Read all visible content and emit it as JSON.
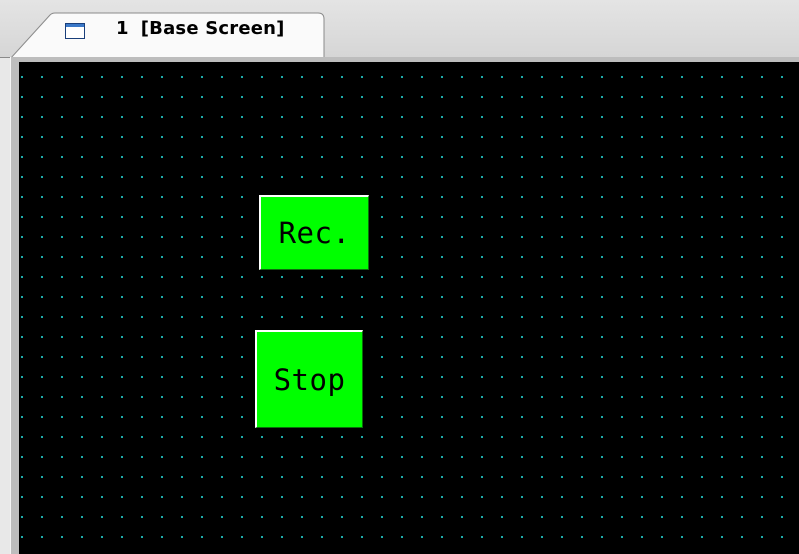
{
  "tab": {
    "number": "1",
    "title": "[Base Screen]",
    "icon": "window-icon"
  },
  "screen": {
    "background_color": "#000000",
    "grid_dot_color": "#1fbfbf",
    "buttons": [
      {
        "label": "Rec.",
        "color": "#00ff00"
      },
      {
        "label": "Stop",
        "color": "#00ff00"
      }
    ]
  }
}
